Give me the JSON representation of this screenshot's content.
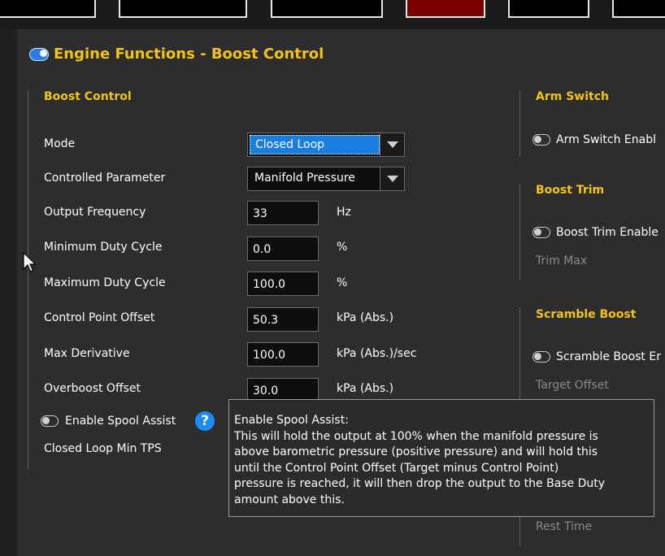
{
  "header": {
    "title": "Engine Functions - Boost Control"
  },
  "boost_control": {
    "heading": "Boost Control",
    "mode": {
      "label": "Mode",
      "value": "Closed Loop"
    },
    "controlled_parameter": {
      "label": "Controlled Parameter",
      "value": "Manifold Pressure"
    },
    "output_frequency": {
      "label": "Output Frequency",
      "value": "33",
      "unit": "Hz"
    },
    "minimum_duty_cycle": {
      "label": "Minimum Duty Cycle",
      "value": "0.0",
      "unit": "%"
    },
    "maximum_duty_cycle": {
      "label": "Maximum Duty Cycle",
      "value": "100.0",
      "unit": "%"
    },
    "control_point_offset": {
      "label": "Control Point Offset",
      "value": "50.3",
      "unit": "kPa (Abs.)"
    },
    "max_derivative": {
      "label": "Max Derivative",
      "value": "100.0",
      "unit": "kPa (Abs.)/sec"
    },
    "overboost_offset": {
      "label": "Overboost Offset",
      "value": "30.0",
      "unit": "kPa (Abs.)"
    },
    "enable_spool_assist": {
      "label": "Enable Spool Assist",
      "help_icon": "question-circle-icon",
      "help_glyph": "?"
    },
    "closed_loop_min_tps": {
      "label": "Closed Loop Min TPS"
    }
  },
  "arm_switch": {
    "heading": "Arm Switch",
    "enable_label": "Arm Switch Enabl"
  },
  "boost_trim": {
    "heading": "Boost Trim",
    "enable_label": "Boost Trim Enable",
    "trim_max_label": "Trim Max"
  },
  "scramble_boost": {
    "heading": "Scramble Boost",
    "enable_label": "Scramble Boost Er",
    "target_offset_label": "Target Offset",
    "rest_time_label": "Rest Time"
  },
  "tooltip": {
    "title": "Enable Spool Assist:",
    "lines": [
      "This will hold the output at 100% when the manifold pressure is",
      "above barometric pressure (positive pressure) and will hold this",
      "until the Control Point Offset (Target minus Control Point)",
      "pressure is reached, it will then drop the output to the Base Duty",
      "amount above this."
    ]
  },
  "colors": {
    "accent": "#f3c416",
    "toggle_on": "#2a7de1",
    "selection": "#1a7de0",
    "help_icon": "#1a8cff",
    "active_toolbar_button": "#7b0000"
  }
}
